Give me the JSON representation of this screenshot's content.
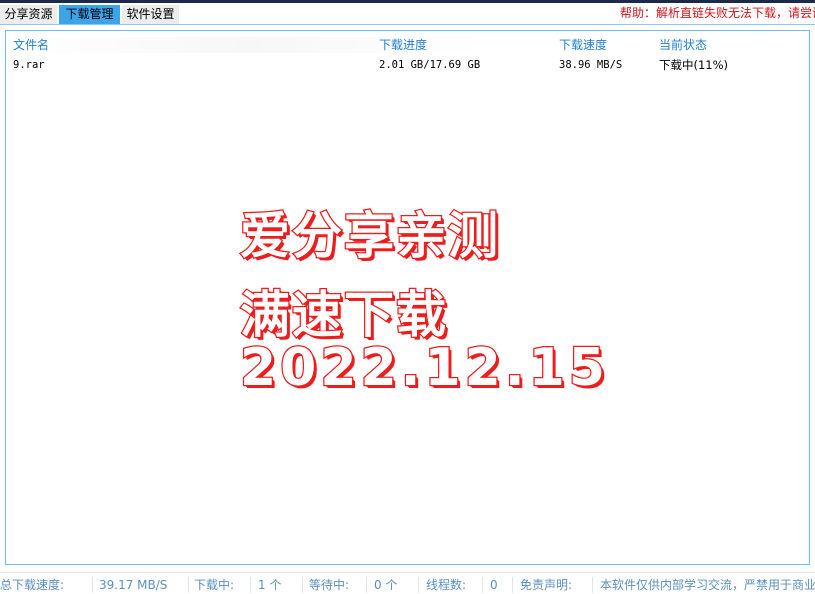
{
  "tabs": [
    {
      "label": "分享资源",
      "active": false
    },
    {
      "label": "下载管理",
      "active": true
    },
    {
      "label": "软件设置",
      "active": false
    }
  ],
  "help_text": "帮助：解析直链失败无法下载，请尝试",
  "table": {
    "columns": [
      "文件名",
      "下载进度",
      "下载速度",
      "当前状态"
    ],
    "rows": [
      {
        "filename": "9.rar",
        "progress": "2.01 GB/17.69 GB",
        "speed": "38.96 MB/S",
        "status": "下载中(11%)"
      }
    ]
  },
  "watermark": {
    "line1": "爱分享亲测",
    "line2": "满速下载",
    "line3": "2022.12.15"
  },
  "statusbar": {
    "total_speed_label": "总下载速度:",
    "total_speed_value": "39.17 MB/S",
    "downloading_label": "下载中:",
    "downloading_value": "1 个",
    "waiting_label": "等待中:",
    "waiting_value": "0 个",
    "threads_label": "线程数:",
    "threads_value": "0",
    "disclaimer_label": "免责声明:",
    "disclaimer_value": "本软件仅供内部学习交流，严禁用于商业"
  },
  "colors": {
    "active_tab": "#3aa5e8",
    "help_text": "#d4141b",
    "column_header": "#1f7fd1",
    "status_text": "#5b8fc0",
    "watermark_stroke": "#ee1c1c"
  }
}
